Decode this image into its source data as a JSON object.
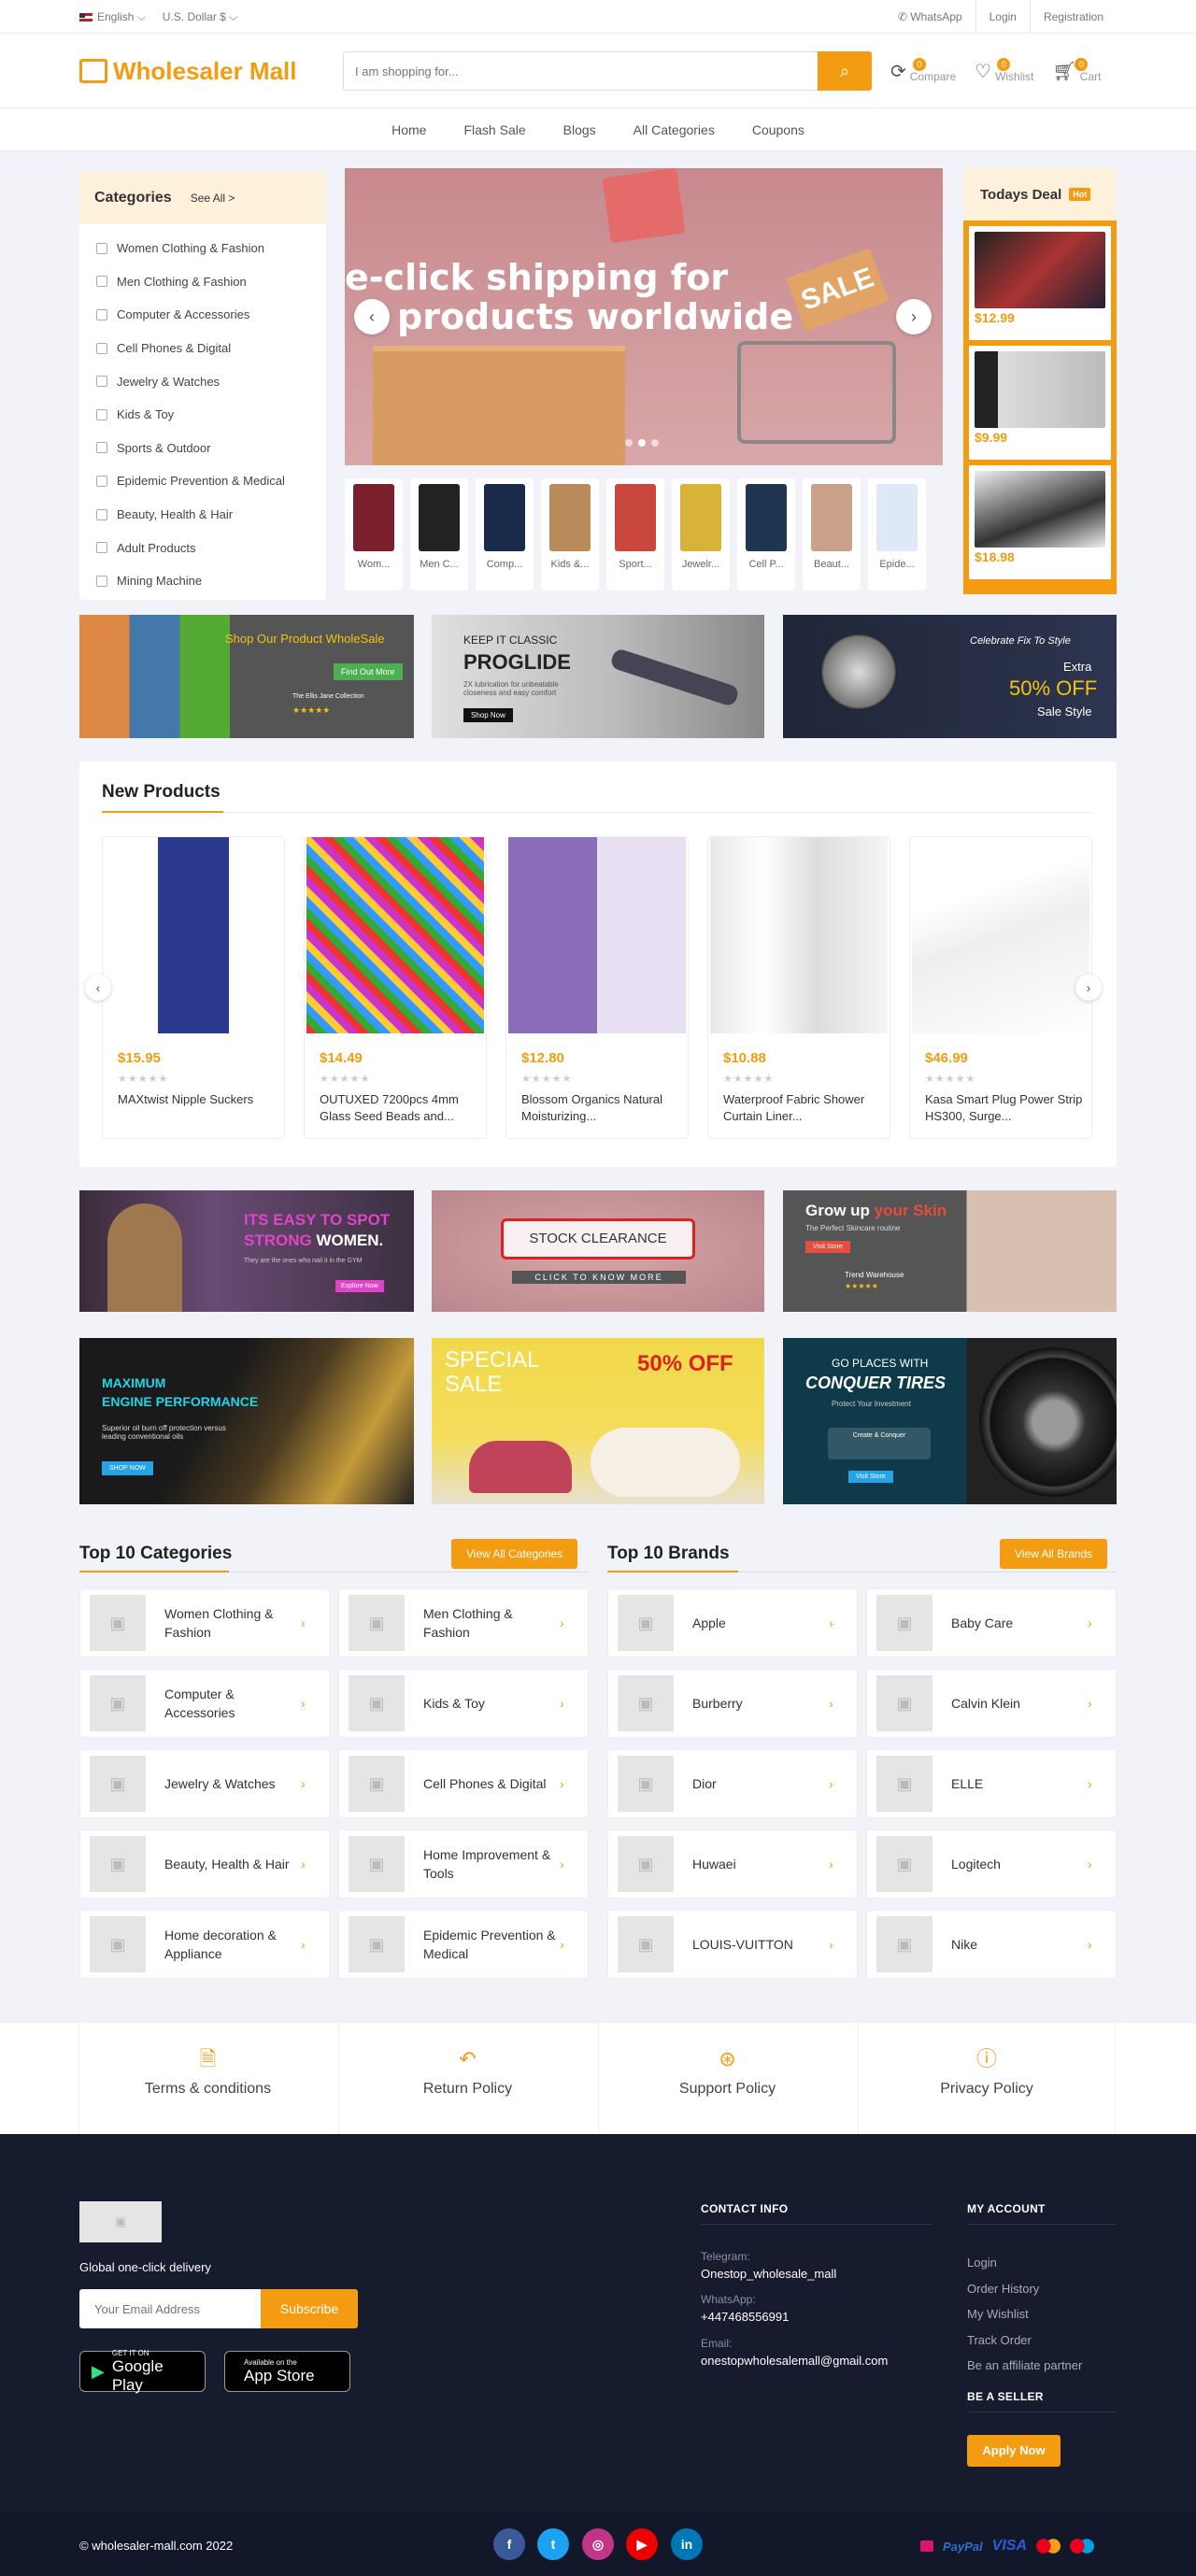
{
  "topbar": {
    "language": "English ⌵",
    "currency": "U.S. Dollar $ ⌵",
    "whatsapp": "WhatsApp",
    "login": "Login",
    "registration": "Registration"
  },
  "header": {
    "logo": "Wholesaler Mall",
    "search_placeholder": "I am shopping for...",
    "compare": {
      "label": "Compare",
      "count": "0"
    },
    "wishlist": {
      "label": "Wishlist",
      "count": "0"
    },
    "cart": {
      "label": "Cart",
      "count": "0"
    }
  },
  "nav": [
    "Home",
    "Flash Sale",
    "Blogs",
    "All Categories",
    "Coupons"
  ],
  "categories": {
    "title": "Categories",
    "see_all": "See All >",
    "items": [
      "Women Clothing & Fashion",
      "Men Clothing & Fashion",
      "Computer & Accessories",
      "Cell Phones & Digital",
      "Jewelry & Watches",
      "Kids & Toy",
      "Sports & Outdoor",
      "Epidemic Prevention & Medical",
      "Beauty, Health & Hair",
      "Adult Products",
      "Mining Machine"
    ]
  },
  "slider": {
    "text_line1": "e-click shipping for",
    "text_line2": "products worldwide",
    "sale_tag": "SALE"
  },
  "thumbs": [
    "Wom...",
    "Men C...",
    "Comp...",
    "Kids &...",
    "Sport...",
    "Jewelr...",
    "Cell P...",
    "Beaut...",
    "Epide..."
  ],
  "deal": {
    "title": "Todays Deal",
    "hot": "Hot",
    "prices": [
      "$12.99",
      "$9.99",
      "$18.98"
    ]
  },
  "banners_row1": {
    "b1_title": "Shop Our Product WholeSale",
    "b1_btn": "Find Out More",
    "b1_sub": "The Ellis Jane Collection",
    "b2_small": "KEEP IT CLASSIC",
    "b2_title": "PROGLIDE",
    "b2_sub": "2X lubrication for unbeatable closeness and easy comfort",
    "b2_btn": "Shop Now",
    "b3_script": "Celebrate Fix To Style",
    "b3_extra": "Extra",
    "b3_off": "50% OFF",
    "b3_sale": "Sale Style"
  },
  "new_products": {
    "title": "New Products",
    "items": [
      {
        "price": "$15.95",
        "name": "MAXtwist Nipple Suckers"
      },
      {
        "price": "$14.49",
        "name": "OUTUXED 7200pcs 4mm Glass Seed Beads and..."
      },
      {
        "price": "$12.80",
        "name": "Blossom Organics Natural Moisturizing..."
      },
      {
        "price": "$10.88",
        "name": "Waterproof Fabric Shower Curtain Liner..."
      },
      {
        "price": "$46.99",
        "name": "Kasa Smart Plug Power Strip HS300, Surge..."
      }
    ],
    "stars": "★★★★★"
  },
  "banners_row2": {
    "b1_line1": "ITS EASY TO SPOT",
    "b1_line2a": "STRONG ",
    "b1_line2b": "WOMEN.",
    "b1_sub": "They are the ones who nail it in the GYM",
    "b1_btn": "Explore Now",
    "b2_title": "STOCK CLEARANCE",
    "b2_sub": "CLICK TO KNOW MORE",
    "b3_title_a": "Grow up ",
    "b3_title_b": "your Skin",
    "b3_sub": "The Perfect Skincare routine",
    "b3_btn": "Visit Store",
    "b3_store": "Trend Warehouse"
  },
  "banners_row3": {
    "b1_line1": "MAXIMUM",
    "b1_line2": "ENGINE PERFORMANCE",
    "b1_sub": "Superior oil burn off protection versus leading conventional oils",
    "b1_btn": "SHOP NOW",
    "b2_special": "SPECIAL",
    "b2_sale": "SALE",
    "b2_off": "50% OFF",
    "b3_small": "GO PLACES WITH",
    "b3_title": "CONQUER TIRES",
    "b3_sub": "Protect Your Investment",
    "b3_store": "Create & Conquer",
    "b3_btn": "Visit Store"
  },
  "top_categories": {
    "title": "Top 10 Categories",
    "btn": "View All Categories",
    "items": [
      "Women Clothing & Fashion",
      "Men Clothing & Fashion",
      "Computer & Accessories",
      "Kids & Toy",
      "Jewelry & Watches",
      "Cell Phones & Digital",
      "Beauty, Health & Hair",
      "Home Improvement & Tools",
      "Home decoration & Appliance",
      "Epidemic Prevention & Medical"
    ]
  },
  "top_brands": {
    "title": "Top 10 Brands",
    "btn": "View All Brands",
    "items": [
      "Apple",
      "Baby Care",
      "Burberry",
      "Calvin Klein",
      "Dior",
      "ELLE",
      "Huwaei",
      "Logitech",
      "LOUIS-VUITTON",
      "Nike"
    ]
  },
  "policies": [
    "Terms & conditions",
    "Return Policy",
    "Support Policy",
    "Privacy Policy"
  ],
  "footer": {
    "tagline": "Global one-click delivery",
    "email_placeholder": "Your Email Address",
    "subscribe": "Subscribe",
    "google_small": "GET IT ON",
    "google_big": "Google Play",
    "apple_small": "Available on the",
    "apple_big": "App Store",
    "contact_title": "CONTACT INFO",
    "telegram_label": "Telegram:",
    "telegram_val": "Onestop_wholesale_mall",
    "whatsapp_label": "WhatsApp:",
    "whatsapp_val": "+447468556991",
    "email_label": "Email:",
    "email_val": "onestopwholesalemall@gmail.com",
    "account_title": "MY ACCOUNT",
    "account_links": [
      "Login",
      "Order History",
      "My Wishlist",
      "Track Order",
      "Be an affiliate partner"
    ],
    "seller_title": "BE A SELLER",
    "seller_btn": "Apply Now",
    "copyright": "© wholesaler-mall.com 2022",
    "social": [
      "f",
      "t",
      "◎",
      "▶",
      "in"
    ],
    "payments": [
      "PayPal",
      "VISA"
    ]
  },
  "colors": {
    "accent": "#f39c12",
    "footer_bg": "#161b2e"
  }
}
